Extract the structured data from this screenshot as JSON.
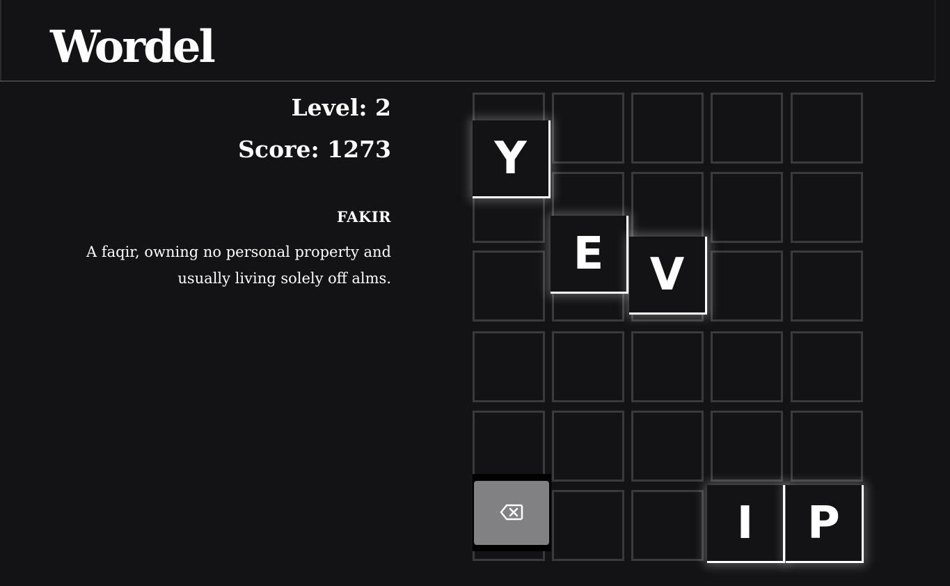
{
  "header": {
    "title": "Wordel"
  },
  "stats": {
    "level_text": "Level: 2",
    "score_text": "Score: 1273"
  },
  "clue": {
    "word": "FAKIR",
    "definition": "A faqir, owning no personal property and usually living solely off alms."
  },
  "board": {
    "rows": 6,
    "cols": 5
  },
  "tiles": [
    {
      "letter": "Y",
      "slot": [
        0,
        0
      ]
    },
    {
      "letter": "E",
      "slot": [
        1,
        1
      ]
    },
    {
      "letter": "V",
      "slot": [
        1,
        2
      ]
    },
    {
      "letter": "I",
      "slot": [
        5,
        3
      ]
    },
    {
      "letter": "P",
      "slot": [
        5,
        4
      ]
    }
  ],
  "delete_button": {
    "icon": "backspace-icon"
  },
  "colors": {
    "background": "#131315",
    "cell_border": "#3a3a3c",
    "tile_highlight": "#ffffff",
    "delete_button": "#818183"
  }
}
